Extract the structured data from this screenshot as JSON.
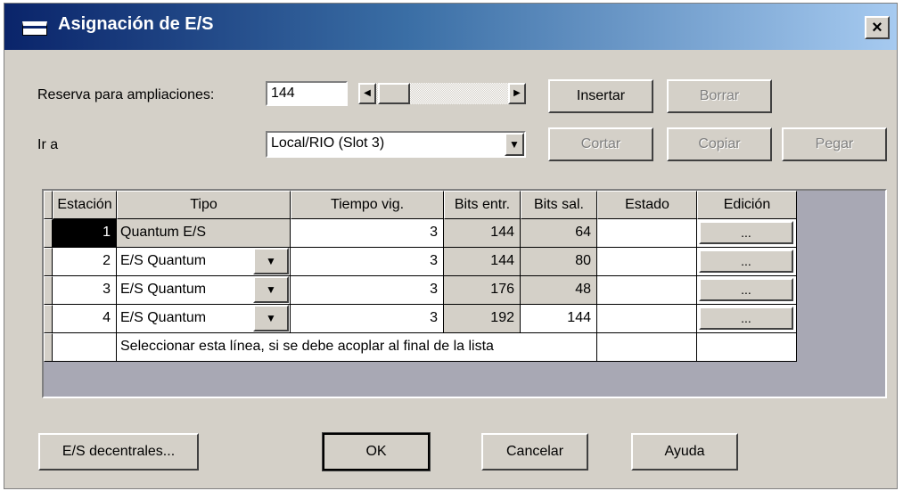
{
  "window": {
    "title": "Asignación de E/S",
    "close_label": "×"
  },
  "reserva": {
    "label": "Reserva para ampliaciones:",
    "value": "144"
  },
  "ir_a": {
    "label": "Ir a",
    "value": "Local/RIO (Slot 3)"
  },
  "buttons": {
    "insertar": "Insertar",
    "borrar": "Borrar",
    "cortar": "Cortar",
    "copiar": "Copiar",
    "pegar": "Pegar",
    "decentrales": "E/S decentrales...",
    "ok": "OK",
    "cancelar": "Cancelar",
    "ayuda": "Ayuda"
  },
  "table": {
    "headers": [
      "Estación",
      "Tipo",
      "Tiempo vig.",
      "Bits entr.",
      "Bits sal.",
      "Estado",
      "Edición"
    ],
    "rows": [
      {
        "station": "1",
        "type": "Quantum E/S",
        "time": "3",
        "bits_in": "144",
        "bits_out": "64",
        "state": "",
        "edit": "..."
      },
      {
        "station": "2",
        "type": "E/S Quantum",
        "time": "3",
        "bits_in": "144",
        "bits_out": "80",
        "state": "",
        "edit": "..."
      },
      {
        "station": "3",
        "type": "E/S Quantum",
        "time": "3",
        "bits_in": "176",
        "bits_out": "48",
        "state": "",
        "edit": "..."
      },
      {
        "station": "4",
        "type": "E/S Quantum",
        "time": "3",
        "bits_in": "192",
        "bits_out": "144",
        "state": "",
        "edit": "..."
      }
    ],
    "append_hint": "Seleccionar esta línea, si se debe acoplar al final de la lista"
  },
  "icons": {
    "dropdown": "chevron-down-icon",
    "scroll_left": "arrow-left-icon",
    "scroll_right": "arrow-right-icon"
  },
  "colors": {
    "title_start": "#0a246a",
    "title_end": "#a6caf0",
    "dialog_bg": "#d4d0c8",
    "grid_bg": "#a8a8b4"
  }
}
